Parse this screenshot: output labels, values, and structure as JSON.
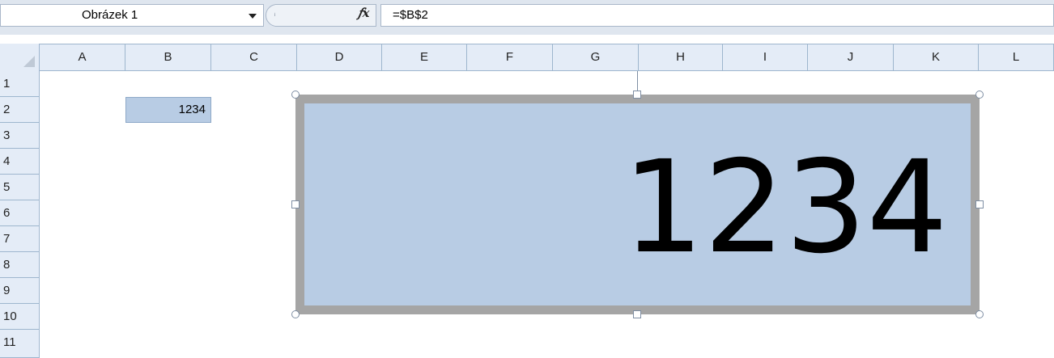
{
  "formula_bar": {
    "name_box": "Obrázek 1",
    "fx_icon": "fx-icon",
    "formula": "=$B$2"
  },
  "columns": [
    "A",
    "B",
    "C",
    "D",
    "E",
    "F",
    "G",
    "H",
    "I",
    "J",
    "K",
    "L"
  ],
  "rows": [
    "1",
    "2",
    "3",
    "4",
    "5",
    "6",
    "7",
    "8",
    "9",
    "10",
    "11"
  ],
  "cells": {
    "B2": "1234"
  },
  "picture": {
    "name": "Obrázek 1",
    "value": "1234"
  },
  "colors": {
    "cell_fill": "#b8cce4",
    "picture_border": "#a5a5a5",
    "header_bg": "#e4ecf7"
  }
}
